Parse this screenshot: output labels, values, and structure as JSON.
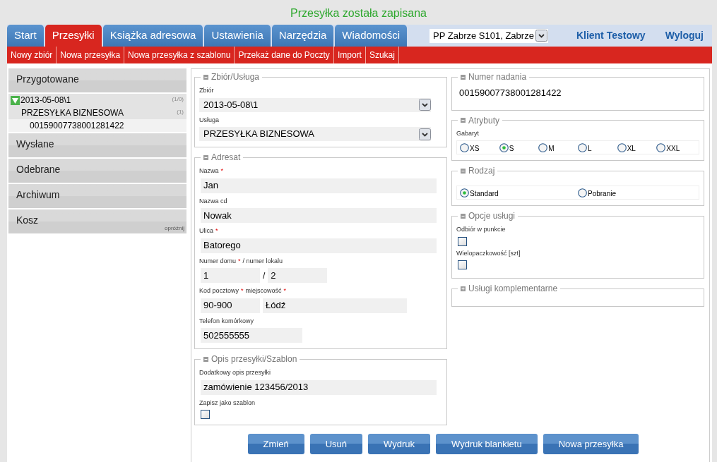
{
  "message": "Przesyłka została zapisana",
  "tabs": [
    {
      "label": "Start",
      "selected": false
    },
    {
      "label": "Przesyłki",
      "selected": true
    },
    {
      "label": "Książka adresowa",
      "selected": false
    },
    {
      "label": "Ustawienia",
      "selected": false
    },
    {
      "label": "Narzędzia",
      "selected": false
    },
    {
      "label": "Wiadomości",
      "selected": false
    }
  ],
  "location_select": {
    "value": "PP Zabrze S101, Zabrze"
  },
  "user": "Klient Testowy",
  "logout": "Wyloguj",
  "subnav": [
    "Nowy zbiór",
    "Nowa przesyłka",
    "Nowa przesyłka z szablonu",
    "Przekaż dane do Poczty",
    "Import",
    "Szukaj"
  ],
  "sidebar": [
    {
      "label": "Przygotowane",
      "children": [
        {
          "label": "2013-05-08\\1",
          "count": "(1/0)",
          "expanded": true,
          "children": [
            {
              "label": "PRZESYŁKA BIZNESOWA",
              "count": "(1)",
              "children": [
                {
                  "label": "00159007738001281422",
                  "selected": true
                }
              ]
            }
          ]
        }
      ]
    },
    {
      "label": "Wysłane"
    },
    {
      "label": "Odebrane"
    },
    {
      "label": "Archiwum"
    },
    {
      "label": "Kosz",
      "action": "opróżnij"
    }
  ],
  "left_groups": [
    {
      "legend": "Zbiór/Usługa",
      "expanded": true,
      "fields": [
        {
          "kind": "select",
          "label": [
            {
              "text": "Zbiór"
            }
          ],
          "values": [
            "2013-05-08\\1"
          ]
        },
        {
          "kind": "select",
          "label": [
            {
              "text": "Usługa"
            }
          ],
          "values": [
            "PRZESYŁKA BIZNESOWA"
          ]
        }
      ]
    },
    {
      "legend": "Adresat",
      "expanded": true,
      "fields": [
        {
          "kind": "text",
          "label": [
            {
              "text": "Nazwa"
            },
            {
              "text": "*",
              "required": true
            }
          ],
          "values": [
            "Jan"
          ]
        },
        {
          "kind": "text",
          "label": [
            {
              "text": "Nazwa cd"
            }
          ],
          "values": [
            "Nowak"
          ]
        },
        {
          "kind": "text",
          "label": [
            {
              "text": "Ulica"
            },
            {
              "text": "*",
              "required": true
            }
          ],
          "values": [
            "Batorego"
          ]
        },
        {
          "kind": "house",
          "label": [
            {
              "text": "Numer domu"
            },
            {
              "text": "*",
              "required": true
            },
            {
              "text": "/ numer lokalu"
            }
          ],
          "values": [
            "1",
            "2"
          ],
          "separator": "/"
        },
        {
          "kind": "postal",
          "label": [
            {
              "text": "Kod pocztowy"
            },
            {
              "text": "*",
              "required": true
            },
            {
              "text": "miejscowość"
            },
            {
              "text": "*",
              "required": true
            }
          ],
          "values": [
            "90-900",
            "Łódź"
          ]
        },
        {
          "kind": "short",
          "label": [
            {
              "text": "Telefon komórkowy"
            }
          ],
          "values": [
            "502555555"
          ]
        }
      ]
    },
    {
      "legend": "Opis przesyłki/Szablon",
      "expanded": true,
      "fields": [
        {
          "kind": "text",
          "label": [
            {
              "text": "Dodatkowy opis przesyłki"
            }
          ],
          "values": [
            "zamówienie 123456/2013"
          ]
        },
        {
          "kind": "checkbox",
          "label": [
            {
              "text": "Zapisz jako szablon"
            }
          ],
          "checked": false
        }
      ]
    }
  ],
  "right_groups": [
    {
      "legend": "Numer nadania",
      "expanded": true,
      "kind": "value",
      "value": "00159007738001281422"
    },
    {
      "legend": "Atrybuty",
      "expanded": true,
      "kind": "radios",
      "label": "Gabaryt",
      "options": [
        {
          "label": "XS",
          "selected": false
        },
        {
          "label": "S",
          "selected": true
        },
        {
          "label": "M",
          "selected": false
        },
        {
          "label": "L",
          "selected": false
        },
        {
          "label": "XL",
          "selected": false
        },
        {
          "label": "XXL",
          "selected": false
        }
      ]
    },
    {
      "legend": "Rodzaj",
      "expanded": true,
      "kind": "radios",
      "options": [
        {
          "label": "Standard",
          "selected": true
        },
        {
          "label": "Pobranie",
          "selected": false
        }
      ]
    },
    {
      "legend": "Opcje usługi",
      "expanded": true,
      "kind": "checkboxes",
      "items": [
        {
          "label": "Odbiór w punkcie",
          "checked": false
        },
        {
          "label": "Wielopaczkowość [szt]",
          "checked": false
        }
      ]
    },
    {
      "legend": "Usługi komplementarne",
      "expanded": false,
      "kind": "empty"
    }
  ],
  "buttons": [
    "Zmień",
    "Usuń",
    "Wydruk",
    "Wydruk blankietu",
    "Nowa przesyłka"
  ]
}
